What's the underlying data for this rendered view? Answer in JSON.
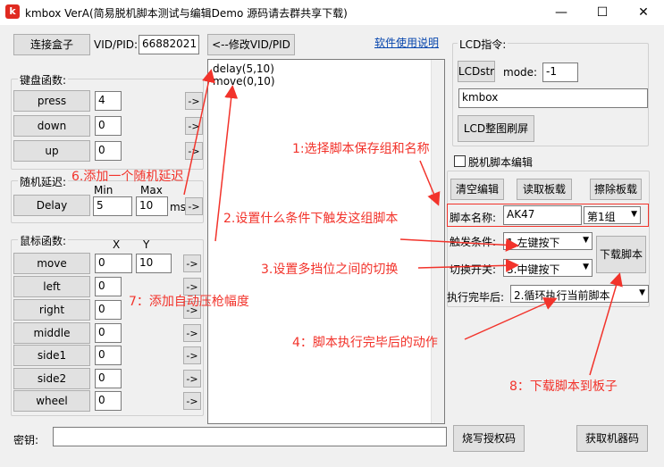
{
  "window": {
    "title": "kmbox VerA(简易脱机脚本测试与编辑Demo 源码请去群共享下载)",
    "min": "—",
    "max": "☐",
    "close": "✕"
  },
  "top": {
    "connect_label": "连接盒子",
    "vidpid_label": "VID/PID:",
    "vidpid_value": "66882021",
    "modify_label": "<--修改VID/PID",
    "help_link": "软件使用说明"
  },
  "keyboard": {
    "group": "键盘函数:",
    "rows": [
      {
        "label": "press",
        "value": "4"
      },
      {
        "label": "down",
        "value": "0"
      },
      {
        "label": "up",
        "value": "0"
      }
    ],
    "arrow": "->"
  },
  "delay": {
    "group": "随机延迟:",
    "min_label": "Min",
    "max_label": "Max",
    "button": "Delay",
    "min_value": "5",
    "max_value": "10",
    "unit": "ms",
    "arrow": "->"
  },
  "mouse": {
    "group": "鼠标函数:",
    "x_label": "X",
    "y_label": "Y",
    "move": {
      "label": "move",
      "x": "0",
      "y": "10"
    },
    "rows": [
      {
        "label": "left",
        "value": "0"
      },
      {
        "label": "right",
        "value": "0"
      },
      {
        "label": "middle",
        "value": "0"
      },
      {
        "label": "side1",
        "value": "0"
      },
      {
        "label": "side2",
        "value": "0"
      },
      {
        "label": "wheel",
        "value": "0"
      }
    ],
    "arrow": "->"
  },
  "script": {
    "lines": [
      "delay(5,10)",
      "move(0,10)"
    ]
  },
  "lcd": {
    "group": "LCD指令:",
    "lcdstr": "LCDstr",
    "mode_label": "mode:",
    "mode_value": "-1",
    "text_value": "kmbox",
    "refresh": "LCD整图刷屏"
  },
  "offline": {
    "checkbox_label": "脱机脚本编辑",
    "clear": "清空编辑",
    "read": "读取板载",
    "erase": "擦除板载",
    "name_label": "脚本名称:",
    "name_value": "AK47",
    "group_value": "第1组",
    "trigger_label": "触发条件:",
    "trigger_value": "1.左键按下",
    "switch_label": "切换开关:",
    "switch_value": "3.中键按下",
    "after_label": "执行完毕后:",
    "after_value": "2.循环执行当前脚本",
    "download": "下载脚本"
  },
  "bottom": {
    "key_label": "密钥:",
    "key_value": "",
    "burn": "烧写授权码",
    "get_code": "获取机器码"
  },
  "annotations": {
    "a1": "1:选择脚本保存组和名称",
    "a2": "2.设置什么条件下触发这组脚本",
    "a3": "3.设置多挡位之间的切换",
    "a4": "4：脚本执行完毕后的动作",
    "a6": "6.添加一个随机延迟",
    "a7": "7：添加自动压枪幅度",
    "a8": "8：下载脚本到板子"
  },
  "colors": {
    "annotation": "#f2332b",
    "link": "#0645ad"
  }
}
